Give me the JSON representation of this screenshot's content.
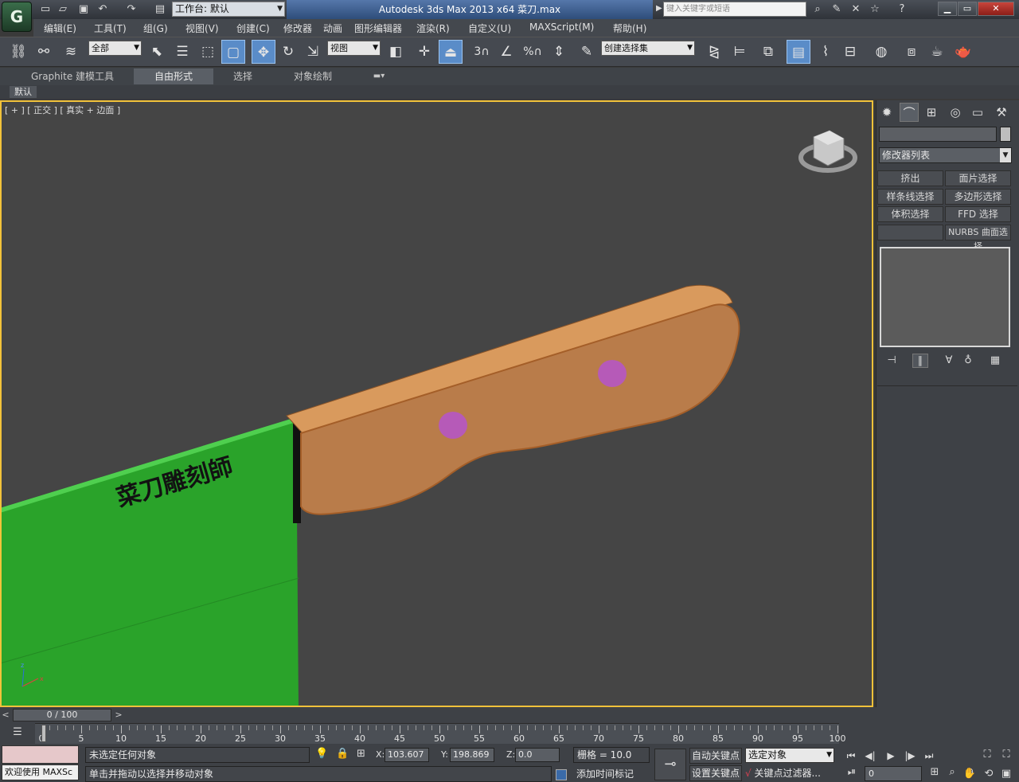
{
  "window": {
    "workspace_label": "工作台: 默认",
    "title": "Autodesk 3ds Max  2013 x64      菜刀.max",
    "search_placeholder": "键入关键字或短语"
  },
  "menu": [
    "编辑(E)",
    "工具(T)",
    "组(G)",
    "视图(V)",
    "创建(C)",
    "修改器",
    "动画",
    "图形编辑器",
    "渲染(R)",
    "自定义(U)",
    "MAXScript(M)",
    "帮助(H)"
  ],
  "toolbar": {
    "selection_filter": "全部",
    "ref_coord": "视图",
    "named_selection": "创建选择集"
  },
  "ribbon": {
    "tabs": [
      "Graphite 建模工具",
      "自由形式",
      "选择",
      "对象绘制"
    ],
    "active_tab": "自由形式",
    "sub_label": "默认"
  },
  "viewport": {
    "label": "[ + ] [ 正交 ] [ 真实 + 边面 ]",
    "engraving": "菜刀雕刻師",
    "colors": {
      "blade": "#2aa32a",
      "handle": "#b97c4a",
      "rivet": "#b65ab8",
      "border": "#f2c23a"
    }
  },
  "command_panel": {
    "tab_icons": [
      "create-icon",
      "modify-icon",
      "hierarchy-icon",
      "motion-icon",
      "display-icon",
      "utilities-icon"
    ],
    "modifier_list": "修改器列表",
    "modifier_buttons": [
      "挤出",
      "面片选择",
      "样条线选择",
      "多边形选择",
      "体积选择",
      "FFD 选择",
      "",
      "NURBS 曲面选择"
    ]
  },
  "timeline": {
    "slider": "0 / 100",
    "ticks": [
      0,
      5,
      10,
      15,
      20,
      25,
      30,
      35,
      40,
      45,
      50,
      55,
      60,
      65,
      70,
      75,
      80,
      85,
      90,
      95,
      100
    ],
    "current_frame": 0,
    "total_frames": 100
  },
  "status": {
    "welcome": "欢迎使用 MAXSc",
    "selection_status": "未选定任何对象",
    "prompt": "单击并拖动以选择并移动对象",
    "x_label": "X:",
    "x": "103.607",
    "y_label": "Y:",
    "y": "198.869",
    "z_label": "Z:",
    "z": "0.0",
    "grid": "栅格 = 10.0",
    "add_time_tag": "添加时间标记",
    "auto_key": "自动关键点",
    "set_key": "设置关键点",
    "selected_object": "选定对象",
    "key_filters": "关键点过滤器...",
    "frame": "0"
  }
}
